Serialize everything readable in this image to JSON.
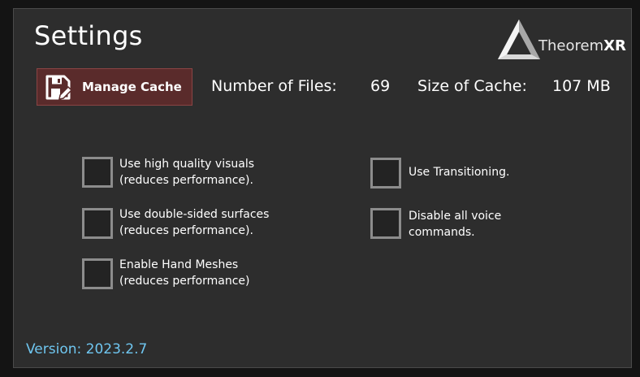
{
  "header": {
    "title": "Settings",
    "logo_text_light": "Theorem",
    "logo_text_bold": "XR"
  },
  "cache": {
    "button_label": "Manage Cache",
    "button_icon": "floppy-disk-edit-icon",
    "files_label": "Number of Files:",
    "files_value": "69",
    "size_label": "Size of Cache:",
    "size_value": "107 MB"
  },
  "options": [
    {
      "line1": "Use high quality visuals",
      "line2": "(reduces performance).",
      "checked": false
    },
    {
      "line1": "Use double-sided surfaces",
      "line2": "(reduces performance).",
      "checked": false
    },
    {
      "line1": "Enable Hand Meshes",
      "line2": "(reduces performance)",
      "checked": false
    },
    {
      "line1": "Use Transitioning.",
      "line2": "",
      "checked": false
    },
    {
      "line1": "Disable all voice",
      "line2": "commands.",
      "checked": false
    }
  ],
  "footer": {
    "version": "Version: 2023.2.7"
  },
  "colors": {
    "panel_bg": "#2d2d2d",
    "button_bg": "#5a2b2b",
    "version_text": "#6fc6f0"
  }
}
